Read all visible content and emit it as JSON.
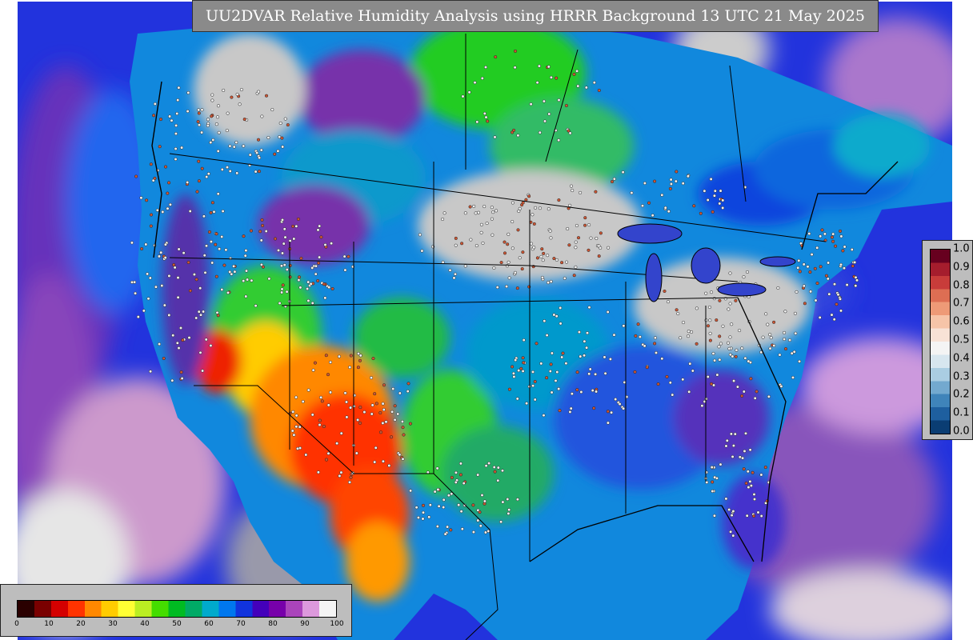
{
  "title": "UU2DVAR Relative Humidity Analysis using HRRR Background 13 UTC 21 May 2025",
  "humidity_legend": {
    "ticks": [
      "0",
      "10",
      "20",
      "30",
      "40",
      "50",
      "60",
      "70",
      "80",
      "90",
      "100"
    ],
    "tick_values": [
      0,
      10,
      20,
      30,
      40,
      50,
      60,
      70,
      80,
      90,
      100
    ],
    "colors": [
      "#2a0000",
      "#7a0000",
      "#d40000",
      "#ff3300",
      "#ff8800",
      "#ffcc00",
      "#ffff33",
      "#bbee22",
      "#44dd00",
      "#00bb22",
      "#00aa66",
      "#00aacc",
      "#0077ee",
      "#1133dd",
      "#4400bb",
      "#7700aa",
      "#aa44bb",
      "#dd99dd",
      "#f4f4f4"
    ]
  },
  "error_legend": {
    "ticks": [
      "1.0",
      "0.9",
      "0.8",
      "0.7",
      "0.6",
      "0.5",
      "0.4",
      "0.3",
      "0.2",
      "0.1",
      "0.0"
    ],
    "tick_values": [
      1.0,
      0.9,
      0.8,
      0.7,
      0.6,
      0.5,
      0.4,
      0.3,
      0.2,
      0.1,
      0.0
    ],
    "colors": [
      "#67001f",
      "#a51d2d",
      "#c83c3a",
      "#dd6e53",
      "#ee9a77",
      "#f6c4a8",
      "#f8e2d6",
      "#f4f4f4",
      "#d7e6ef",
      "#aacde2",
      "#73a9cf",
      "#3f84ba",
      "#1e5f9f",
      "#0a3d73"
    ]
  },
  "map": {
    "ocean_color": "#2233dd",
    "land_base_color": "#1188dd",
    "cloud_color": "#c8c8c8",
    "station_color_moist": "#f0f0f0",
    "station_color_dry": "#cc5533"
  }
}
